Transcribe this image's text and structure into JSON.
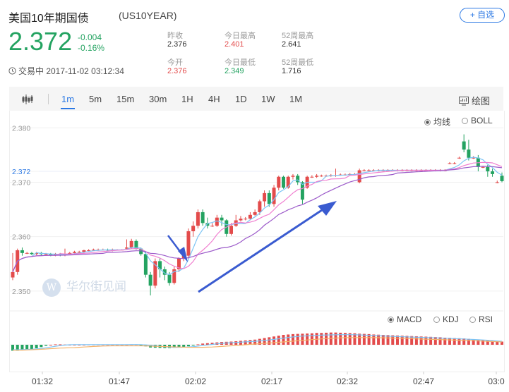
{
  "header": {
    "title": "美国10年期国债",
    "code": "(US10YEAR)",
    "add_label": "+ 自选"
  },
  "quote": {
    "price": "2.372",
    "change": "-0.004",
    "change_pct": "-0.16%",
    "stats": [
      {
        "label": "昨收",
        "value": "2.376",
        "tone": "neutral"
      },
      {
        "label": "今日最高",
        "value": "2.401",
        "tone": "red"
      },
      {
        "label": "52周最高",
        "value": "2.641",
        "tone": "neutral"
      },
      {
        "label": "今开",
        "value": "2.376",
        "tone": "red"
      },
      {
        "label": "今日最低",
        "value": "2.349",
        "tone": "green"
      },
      {
        "label": "52周最低",
        "value": "1.716",
        "tone": "neutral"
      }
    ],
    "status": "交易中 2017-11-02 03:12:34"
  },
  "toolbar": {
    "periods": [
      "1m",
      "5m",
      "15m",
      "30m",
      "1H",
      "4H",
      "1D",
      "1W",
      "1M"
    ],
    "active": "1m",
    "draw_label": "绘图"
  },
  "chart_legend": {
    "main": [
      {
        "label": "均线",
        "checked": true
      },
      {
        "label": "BOLL",
        "checked": false
      }
    ],
    "sub": [
      {
        "label": "MACD",
        "checked": true
      },
      {
        "label": "KDJ",
        "checked": false
      },
      {
        "label": "RSI",
        "checked": false
      }
    ]
  },
  "watermark": "华尔街见闻",
  "colors": {
    "up": "#e34b4b",
    "down": "#24a361",
    "accent": "#2b78e4"
  },
  "chart_data": {
    "type": "candlestick",
    "y_ticks": [
      "2.380",
      "2.372",
      "2.370",
      "2.360",
      "2.350"
    ],
    "x_ticks": [
      "01:32",
      "01:47",
      "02:02",
      "02:17",
      "02:32",
      "02:47",
      "03:0"
    ],
    "ylim": [
      2.347,
      2.3825
    ],
    "current": 2.372,
    "candles": [
      [
        2.3525,
        2.3535,
        2.352,
        2.357
      ],
      [
        2.3535,
        2.3575,
        2.353,
        2.3578
      ],
      [
        2.3575,
        2.357,
        2.3565,
        2.358
      ],
      [
        2.357,
        2.357,
        2.3568,
        2.3572
      ],
      [
        2.357,
        2.3568,
        2.3566,
        2.3572
      ],
      [
        2.3568,
        2.357,
        2.3566,
        2.3572
      ],
      [
        2.357,
        2.3568,
        2.3566,
        2.3572
      ],
      [
        2.3568,
        2.3568,
        2.3566,
        2.357
      ],
      [
        2.3568,
        2.3566,
        2.3564,
        2.357
      ],
      [
        2.3566,
        2.3568,
        2.3564,
        2.357
      ],
      [
        2.3568,
        2.3566,
        2.3564,
        2.357
      ],
      [
        2.3566,
        2.3568,
        2.3564,
        2.3578
      ],
      [
        2.3568,
        2.357,
        2.3566,
        2.3572
      ],
      [
        2.357,
        2.3572,
        2.3568,
        2.3574
      ],
      [
        2.3572,
        2.3572,
        2.357,
        2.3574
      ],
      [
        2.3572,
        2.3575,
        2.357,
        2.3576
      ],
      [
        2.3575,
        2.3575,
        2.3573,
        2.3577
      ],
      [
        2.3575,
        2.3576,
        2.3574,
        2.3578
      ],
      [
        2.3576,
        2.3576,
        2.3574,
        2.3578
      ],
      [
        2.3576,
        2.3576,
        2.3575,
        2.3578
      ],
      [
        2.3576,
        2.3575,
        2.3574,
        2.3578
      ],
      [
        2.3575,
        2.3576,
        2.3573,
        2.3578
      ],
      [
        2.3576,
        2.3576,
        2.3575,
        2.3577
      ],
      [
        2.3576,
        2.3576,
        2.3575,
        2.3577
      ],
      [
        2.3578,
        2.358,
        2.3576,
        2.3595
      ],
      [
        2.358,
        2.3592,
        2.3578,
        2.3596
      ],
      [
        2.3592,
        2.3578,
        2.3576,
        2.3595
      ],
      [
        2.3578,
        2.3568,
        2.3565,
        2.358
      ],
      [
        2.3568,
        2.353,
        2.3525,
        2.3572
      ],
      [
        2.353,
        2.351,
        2.3492,
        2.3535
      ],
      [
        2.351,
        2.3555,
        2.3505,
        2.356
      ],
      [
        2.3555,
        2.354,
        2.3525,
        2.356
      ],
      [
        2.354,
        2.353,
        2.352,
        2.3545
      ],
      [
        2.353,
        2.3515,
        2.351,
        2.3535
      ],
      [
        2.3515,
        2.354,
        2.3512,
        2.3545
      ],
      [
        2.354,
        2.356,
        2.3535,
        2.3562
      ],
      [
        2.356,
        2.3565,
        2.3555,
        2.3575
      ],
      [
        2.3565,
        2.361,
        2.356,
        2.3615
      ],
      [
        2.361,
        2.362,
        2.36,
        2.3628
      ],
      [
        2.362,
        2.3645,
        2.3615,
        2.365
      ],
      [
        2.3645,
        2.3625,
        2.362,
        2.365
      ],
      [
        2.3625,
        2.362,
        2.3615,
        2.3635
      ],
      [
        2.362,
        2.362,
        2.3618,
        2.3625
      ],
      [
        2.362,
        2.3635,
        2.3618,
        2.364
      ],
      [
        2.3635,
        2.363,
        2.362,
        2.364
      ],
      [
        2.363,
        2.3605,
        2.36,
        2.3632
      ],
      [
        2.3605,
        2.362,
        2.3602,
        2.3625
      ],
      [
        2.362,
        2.363,
        2.3618,
        2.364
      ],
      [
        2.363,
        2.3633,
        2.3628,
        2.3638
      ],
      [
        2.3633,
        2.3633,
        2.363,
        2.3636
      ],
      [
        2.3633,
        2.364,
        2.363,
        2.3645
      ],
      [
        2.364,
        2.3645,
        2.3638,
        2.365
      ],
      [
        2.3645,
        2.3665,
        2.364,
        2.3668
      ],
      [
        2.3665,
        2.368,
        2.3655,
        2.3685
      ],
      [
        2.368,
        2.366,
        2.3655,
        2.3685
      ],
      [
        2.366,
        2.369,
        2.3655,
        2.3695
      ],
      [
        2.369,
        2.371,
        2.3685,
        2.3712
      ],
      [
        2.371,
        2.369,
        2.3688,
        2.3712
      ],
      [
        2.369,
        2.371,
        2.3688,
        2.3712
      ],
      [
        2.371,
        2.3712,
        2.3705,
        2.3715
      ],
      [
        2.3712,
        2.37,
        2.3695,
        2.3715
      ],
      [
        2.37,
        2.3668,
        2.366,
        2.3702
      ],
      [
        2.369,
        2.371,
        2.3688,
        2.3712
      ],
      [
        2.371,
        2.371,
        2.3708,
        2.3713
      ],
      [
        2.371,
        2.3712,
        2.3708,
        2.3715
      ],
      [
        2.3712,
        2.3712,
        2.371,
        2.3714
      ],
      [
        2.3712,
        2.3712,
        2.371,
        2.3714
      ],
      [
        2.3712,
        2.3713,
        2.371,
        2.3715
      ],
      [
        2.3713,
        2.3713,
        2.371,
        2.3725
      ],
      [
        2.3713,
        2.3714,
        2.3712,
        2.3716
      ],
      [
        2.3714,
        2.3714,
        2.3712,
        2.3716
      ],
      [
        2.3714,
        2.3715,
        2.3713,
        2.3717
      ],
      [
        2.3715,
        2.3715,
        2.3713,
        2.3717
      ],
      [
        2.37,
        2.3722,
        2.3698,
        2.3725
      ],
      [
        2.3722,
        2.3722,
        2.372,
        2.3724
      ],
      [
        2.3722,
        2.3722,
        2.372,
        2.3724
      ],
      [
        2.3722,
        2.3722,
        2.372,
        2.3724
      ],
      [
        2.3722,
        2.3722,
        2.372,
        2.3724
      ],
      [
        2.3722,
        2.3722,
        2.372,
        2.3724
      ],
      [
        2.3722,
        2.3722,
        2.372,
        2.3724
      ],
      [
        2.3722,
        2.3722,
        2.372,
        2.3724
      ],
      [
        2.3722,
        2.3722,
        2.372,
        2.3724
      ],
      [
        2.3722,
        2.3722,
        2.372,
        2.3724
      ],
      [
        2.3722,
        2.3722,
        2.372,
        2.3724
      ],
      [
        2.3722,
        2.3722,
        2.372,
        2.3724
      ],
      [
        2.3722,
        2.3722,
        2.372,
        2.3724
      ],
      [
        2.3722,
        2.3722,
        2.372,
        2.3724
      ],
      [
        2.3722,
        2.3722,
        2.372,
        2.3724
      ],
      [
        2.3722,
        2.3722,
        2.372,
        2.3724
      ],
      [
        2.3722,
        2.3722,
        2.372,
        2.3724
      ],
      [
        2.3722,
        2.3722,
        2.372,
        2.3724
      ],
      [
        2.3722,
        2.3722,
        2.372,
        2.3724
      ],
      [
        2.3735,
        2.3735,
        2.3733,
        2.3737
      ],
      [
        2.3735,
        2.3735,
        2.3733,
        2.3737
      ],
      [
        2.3745,
        2.3745,
        2.3743,
        2.3747
      ],
      [
        2.3775,
        2.376,
        2.3755,
        2.3788
      ],
      [
        2.376,
        2.3745,
        2.374,
        2.3778
      ],
      [
        2.3745,
        2.3745,
        2.3743,
        2.3748
      ],
      [
        2.3745,
        2.3728,
        2.372,
        2.375
      ],
      [
        2.3728,
        2.3728,
        2.3726,
        2.373
      ],
      [
        2.3728,
        2.372,
        2.371,
        2.3732
      ],
      [
        2.372,
        2.3715,
        2.371,
        2.3725
      ],
      [
        2.37,
        2.37,
        2.3698,
        2.3703
      ],
      [
        2.3712,
        2.3702,
        2.37,
        2.3718
      ]
    ],
    "macd": [
      -0.3,
      -0.3,
      -0.28,
      -0.25,
      -0.22,
      -0.18,
      -0.12,
      -0.05,
      0.0,
      0.02,
      0.02,
      0.01,
      0.0,
      0.0,
      0.0,
      0.0,
      0.01,
      0.01,
      0.01,
      0.01,
      0.01,
      0.01,
      0.01,
      0.01,
      0.01,
      0.02,
      0.02,
      -0.02,
      -0.08,
      -0.14,
      -0.15,
      -0.16,
      -0.17,
      -0.17,
      -0.15,
      -0.12,
      -0.12,
      -0.08,
      -0.04,
      0.02,
      0.06,
      0.08,
      0.1,
      0.12,
      0.14,
      0.15,
      0.16,
      0.18,
      0.2,
      0.22,
      0.24,
      0.26,
      0.3,
      0.34,
      0.38,
      0.42,
      0.46,
      0.5,
      0.52,
      0.54,
      0.55,
      0.56,
      0.57,
      0.58,
      0.6,
      0.6,
      0.61,
      0.62,
      0.62,
      0.61,
      0.6,
      0.59,
      0.58,
      0.56,
      0.55,
      0.54,
      0.52,
      0.51,
      0.5,
      0.49,
      0.48,
      0.47,
      0.46,
      0.45,
      0.44,
      0.43,
      0.42,
      0.41,
      0.4,
      0.39,
      0.38,
      0.36,
      0.35,
      0.34,
      0.33,
      0.32,
      0.3,
      0.28,
      0.26,
      0.24,
      0.22,
      0.2,
      0.18,
      0.16
    ]
  }
}
